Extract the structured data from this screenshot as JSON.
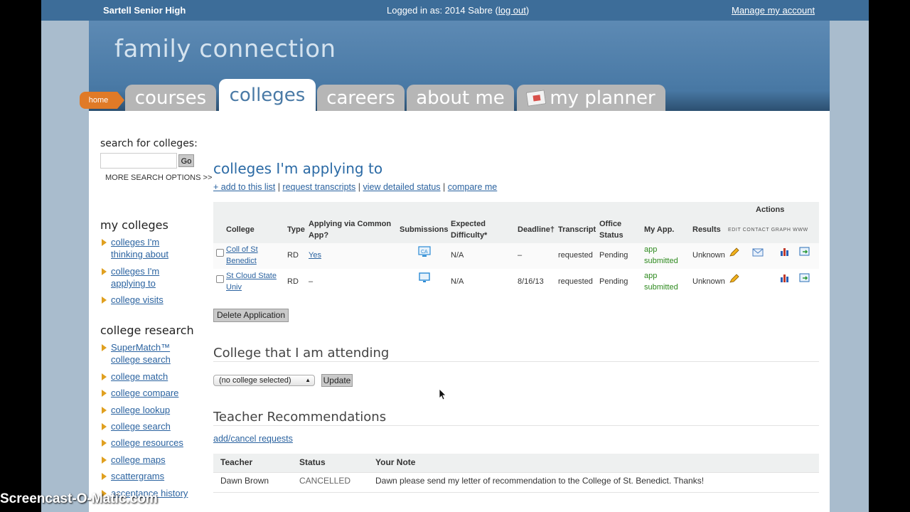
{
  "topbar": {
    "school": "Sartell Senior High",
    "logged_in_prefix": "Logged in as: 2014 Sabre (",
    "logout": "log out",
    "logged_in_suffix": ")",
    "manage": "Manage my account"
  },
  "brand": "family connection",
  "tabs": {
    "home": "home",
    "courses": "courses",
    "colleges": "colleges",
    "careers": "careers",
    "about": "about me",
    "planner": "my planner"
  },
  "sidebar": {
    "search_label": "search for colleges:",
    "search_placeholder": "",
    "go": "Go",
    "more_options": "MORE SEARCH OPTIONS >>",
    "my_colleges_heading": "my colleges",
    "my_colleges": [
      "colleges I'm",
      "thinking about",
      "colleges I'm",
      "applying to",
      "college visits"
    ],
    "research_heading": "college research",
    "research": [
      "SuperMatch™",
      "college search",
      "college match",
      "college compare",
      "college lookup",
      "college search",
      "college resources",
      "college maps",
      "scattergrams",
      "acceptance history"
    ]
  },
  "main": {
    "heading": "colleges I'm applying to",
    "links": [
      "+ add to this list",
      "request transcripts",
      "view detailed status",
      "compare me"
    ],
    "sep": "|",
    "table": {
      "actions": "Actions",
      "headers": {
        "college": "College",
        "type": "Type",
        "common_app_1": "Applying via Common",
        "common_app_2": "App?",
        "submissions": "Submissions",
        "difficulty_1": "Expected",
        "difficulty_2": "Difficulty*",
        "deadline": "Deadline†",
        "transcript": "Transcript",
        "office_1": "Office",
        "office_2": "Status",
        "myapp": "My App.",
        "results": "Results",
        "action_labels": "EDIT CONTACT GRAPH WWW"
      },
      "rows": [
        {
          "college_1": "Coll of St",
          "college_2": "Benedict",
          "type": "RD",
          "common_app": "Yes",
          "difficulty": "N/A",
          "deadline": "–",
          "transcript": "requested",
          "office": "Pending",
          "myapp_1": "app",
          "myapp_2": "submitted",
          "results": "Unknown"
        },
        {
          "college_1": "St Cloud State",
          "college_2": "Univ",
          "type": "RD",
          "common_app": "–",
          "difficulty": "N/A",
          "deadline": "8/16/13",
          "transcript": "requested",
          "office": "Pending",
          "myapp_1": "app",
          "myapp_2": "submitted",
          "results": "Unknown"
        }
      ]
    },
    "delete_btn": "Delete Application",
    "attending_heading": "College that I am attending",
    "select_value": "(no college selected)",
    "update_btn": "Update",
    "recs_heading": "Teacher Recommendations",
    "recs_link": "add/cancel requests",
    "recs_headers": {
      "teacher": "Teacher",
      "status": "Status",
      "note": "Your Note"
    },
    "recs_row": {
      "teacher": "Dawn Brown",
      "status": "CANCELLED",
      "note": "Dawn please send my letter of recommendation to the College of St. Benedict. Thanks!"
    }
  },
  "watermark": "Screencast-O-Matic.com"
}
